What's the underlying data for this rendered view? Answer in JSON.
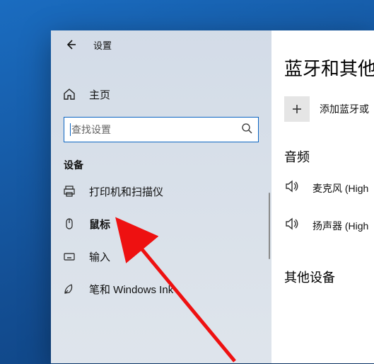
{
  "header": {
    "title": "设置"
  },
  "home_label": "主页",
  "search": {
    "placeholder": "查找设置"
  },
  "section_label": "设备",
  "nav": {
    "printers": "打印机和扫描仪",
    "mouse": "鼠标",
    "typing": "输入",
    "pen": "笔和 Windows Ink"
  },
  "content": {
    "page_title": "蓝牙和其他",
    "add_label": "添加蓝牙或",
    "audio_header": "音频",
    "mic_name": "麦克风 (High",
    "speaker_name": "扬声器 (High",
    "other_header": "其他设备"
  }
}
